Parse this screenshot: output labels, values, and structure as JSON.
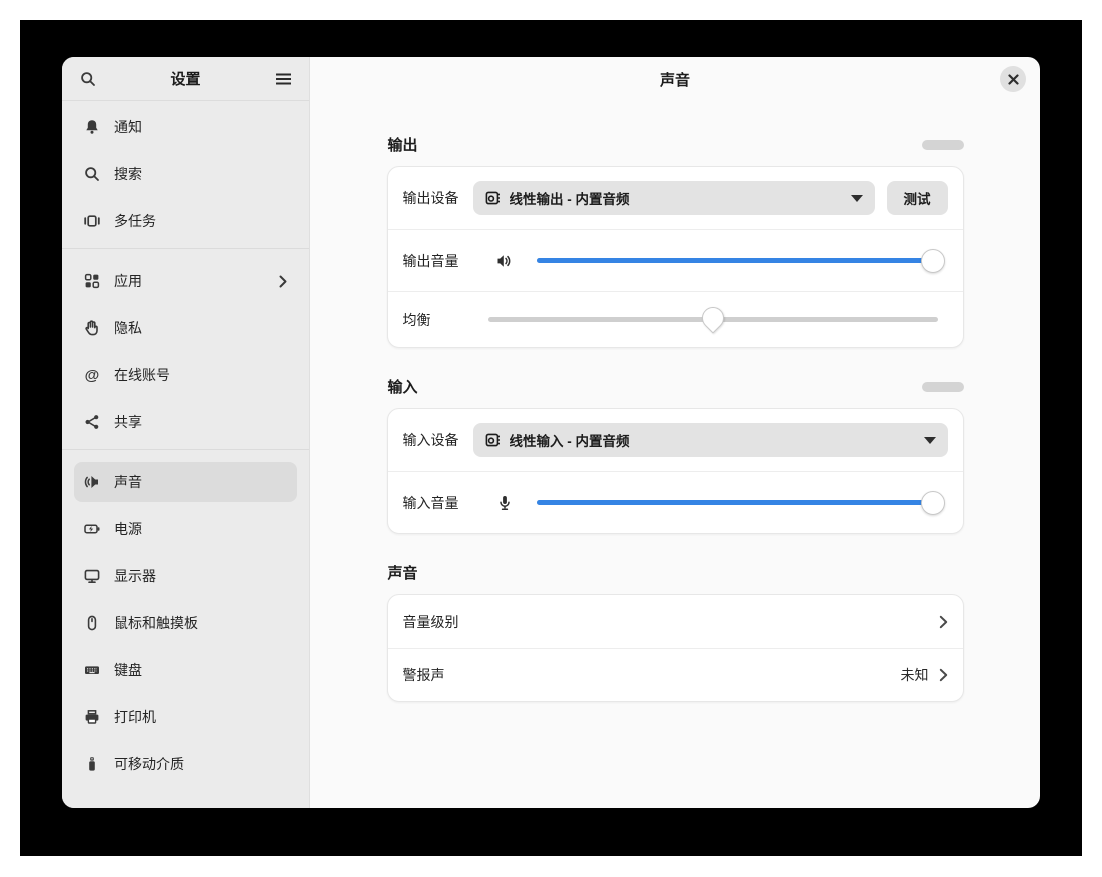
{
  "sidebar": {
    "title": "设置",
    "icons": {
      "search": "search-icon",
      "menu": "hamburger-menu-icon"
    },
    "groups": [
      {
        "items": [
          {
            "label": "通知",
            "icon": "bell-icon"
          },
          {
            "label": "搜索",
            "icon": "search-icon"
          },
          {
            "label": "多任务",
            "icon": "multitasking-icon"
          }
        ]
      },
      {
        "items": [
          {
            "label": "应用",
            "icon": "apps-grid-icon",
            "chevron": true
          },
          {
            "label": "隐私",
            "icon": "hand-icon"
          },
          {
            "label": "在线账号",
            "icon": "at-icon",
            "at_glyph": "@"
          },
          {
            "label": "共享",
            "icon": "share-icon"
          }
        ]
      },
      {
        "items": [
          {
            "label": "声音",
            "icon": "speaker-icon",
            "selected": true
          },
          {
            "label": "电源",
            "icon": "battery-icon"
          },
          {
            "label": "显示器",
            "icon": "monitor-icon"
          },
          {
            "label": "鼠标和触摸板",
            "icon": "mouse-icon"
          },
          {
            "label": "键盘",
            "icon": "keyboard-icon"
          },
          {
            "label": "打印机",
            "icon": "printer-icon"
          },
          {
            "label": "可移动介质",
            "icon": "usb-stick-icon"
          }
        ]
      }
    ]
  },
  "header": {
    "title": "声音",
    "close_icon": "close-icon"
  },
  "output": {
    "section_title": "输出",
    "device_label": "输出设备",
    "device_value": "线性输出 - 内置音频",
    "device_icon": "audio-card-icon",
    "test_button": "测试",
    "volume_label": "输出音量",
    "volume_icon": "speaker-volume-icon",
    "volume_percent": 99,
    "balance_label": "均衡",
    "balance_percent": 50
  },
  "input": {
    "section_title": "输入",
    "device_label": "输入设备",
    "device_value": "线性输入 - 内置音频",
    "device_icon": "audio-card-icon",
    "volume_label": "输入音量",
    "volume_icon": "microphone-icon",
    "volume_percent": 99
  },
  "sounds": {
    "section_title": "声音",
    "rows": [
      {
        "label": "音量级别",
        "value": ""
      },
      {
        "label": "警报声",
        "value": "未知"
      }
    ]
  },
  "colors": {
    "accent_blue": "#3584e4",
    "sidebar_bg": "#ebebeb",
    "main_bg": "#fafafa",
    "selected_bg": "#dcdcdc",
    "control_bg": "#e3e3e3",
    "frame_bg": "#000000"
  }
}
